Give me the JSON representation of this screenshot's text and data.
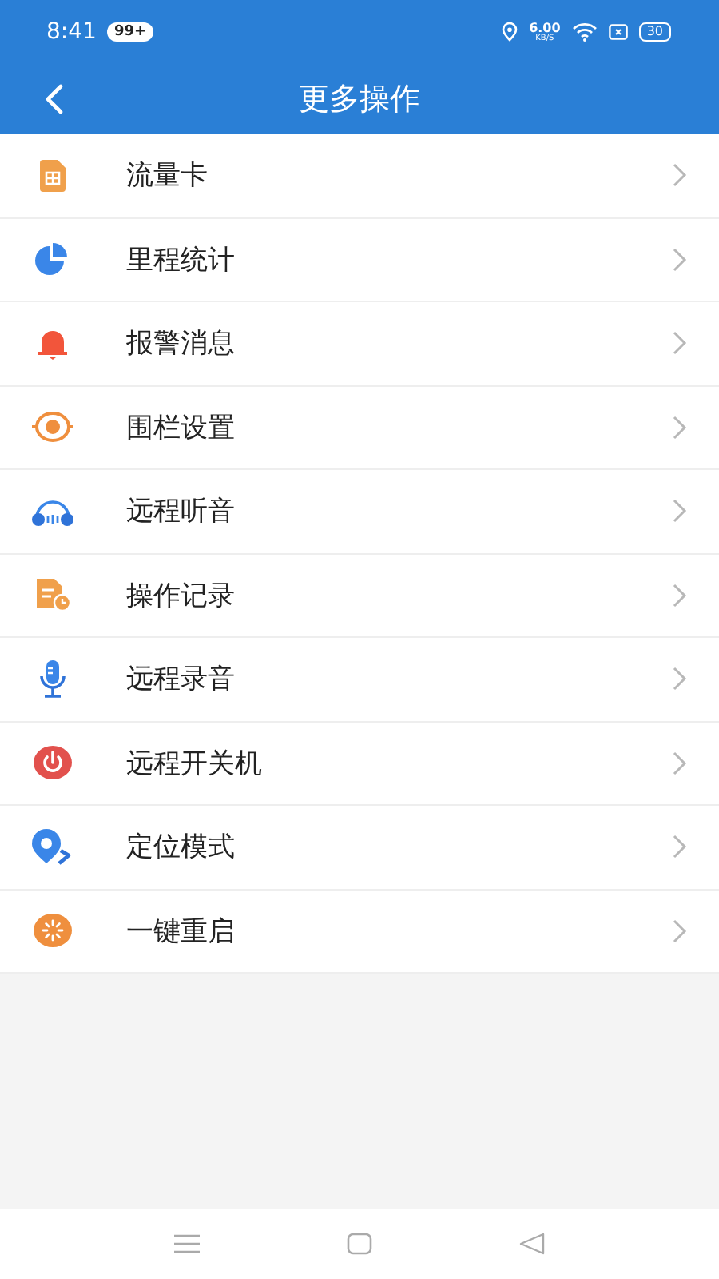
{
  "status_bar": {
    "time": "8:41",
    "badge": "99+",
    "speed": "6.00",
    "speed_unit": "KB/S",
    "battery": "30"
  },
  "header": {
    "title": "更多操作"
  },
  "items": [
    {
      "label": "流量卡",
      "kind": "sim"
    },
    {
      "label": "里程统计",
      "kind": "pie"
    },
    {
      "label": "报警消息",
      "kind": "bell"
    },
    {
      "label": "围栏设置",
      "kind": "target"
    },
    {
      "label": "远程听音",
      "kind": "headphones"
    },
    {
      "label": "操作记录",
      "kind": "log"
    },
    {
      "label": "远程录音",
      "kind": "mic"
    },
    {
      "label": "远程开关机",
      "kind": "power"
    },
    {
      "label": "定位模式",
      "kind": "location"
    },
    {
      "label": "一键重启",
      "kind": "restart"
    }
  ]
}
